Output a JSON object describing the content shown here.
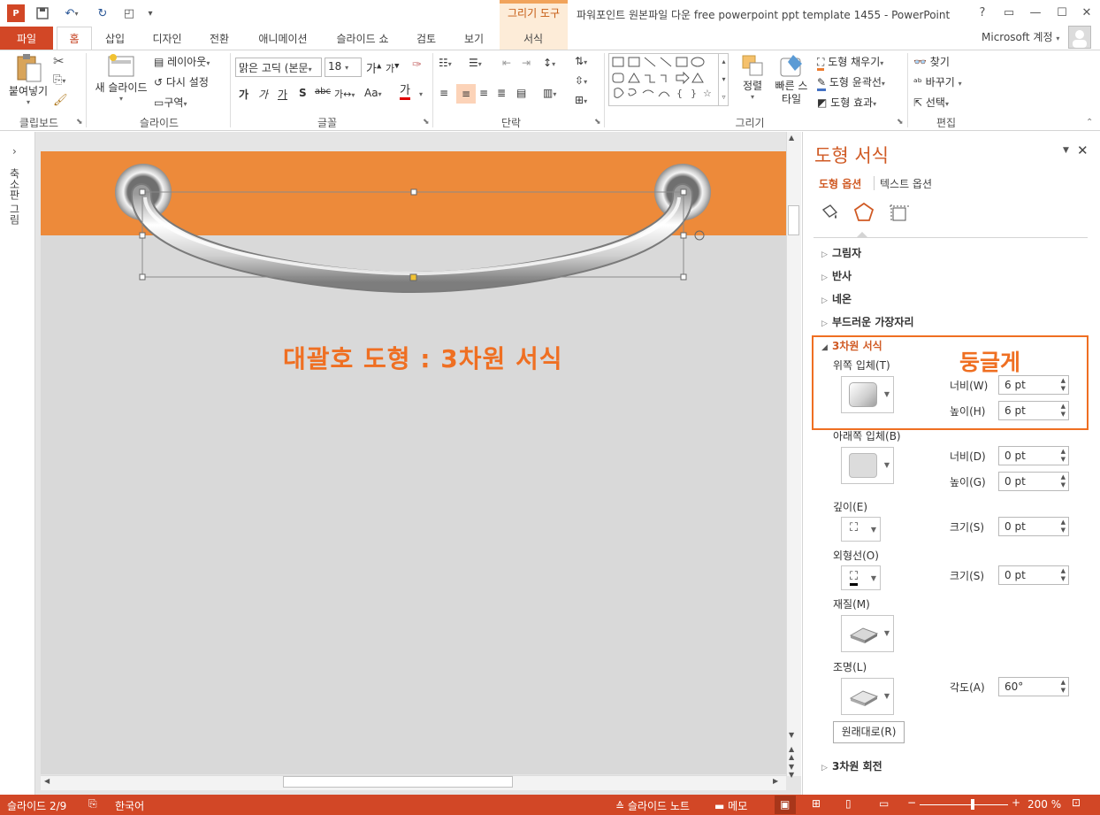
{
  "app": {
    "document_title": "파워포인트 원본파일 다운 free powerpoint ppt template 1455 - PowerPoint",
    "context_tab": "그리기 도구",
    "window_buttons": [
      "?",
      "▭",
      "—",
      "☐",
      "✕"
    ]
  },
  "tabs": {
    "file": "파일",
    "items": [
      "홈",
      "삽입",
      "디자인",
      "전환",
      "애니메이션",
      "슬라이드 쇼",
      "검토",
      "보기",
      "서식"
    ],
    "active": "홈",
    "account": "Microsoft 계정"
  },
  "ribbon": {
    "clipboard": {
      "label": "클립보드",
      "paste": "붙여넣기"
    },
    "slides": {
      "label": "슬라이드",
      "new_slide": "새 슬라이드",
      "layout": "레이아웃",
      "reset": "다시 설정",
      "section": "구역"
    },
    "font": {
      "label": "글꼴",
      "font_name": "맑은 고딕 (본문",
      "font_size": "18"
    },
    "paragraph": {
      "label": "단락"
    },
    "drawing": {
      "label": "그리기",
      "arrange": "정렬",
      "quick_styles": "빠른 스타일",
      "shape_fill": "도형 채우기",
      "shape_outline": "도형 윤곽선",
      "shape_effects": "도형 효과"
    },
    "editing": {
      "label": "편집",
      "find": "찾기",
      "replace": "바꾸기",
      "select": "선택"
    }
  },
  "left_strip": {
    "label": "축소판 그림"
  },
  "slide": {
    "caption": "대괄호 도형 : 3차원 서식",
    "band_color": "#ED8A3A",
    "background_color": "#D9D9D9"
  },
  "pane": {
    "title": "도형 서식",
    "tab_shape": "도형 옵션",
    "tab_text": "텍스트 옵션",
    "sections": {
      "shadow": "그림자",
      "reflection": "반사",
      "glow": "네온",
      "soft_edges": "부드러운 가장자리",
      "format_3d": "3차원 서식",
      "rotation_3d": "3차원 회전"
    },
    "top_bevel": {
      "label": "위쪽 입체(T)",
      "width_label": "너비(W)",
      "width": "6 pt",
      "height_label": "높이(H)",
      "height": "6 pt"
    },
    "bottom_bevel": {
      "label": "아래쪽 입체(B)",
      "width_label": "너비(D)",
      "width": "0 pt",
      "height_label": "높이(G)",
      "height": "0 pt"
    },
    "depth": {
      "label": "깊이(E)",
      "size_label": "크기(S)",
      "size": "0 pt"
    },
    "contour": {
      "label": "외형선(O)",
      "size_label": "크기(S)",
      "size": "0 pt"
    },
    "material": {
      "label": "재질(M)"
    },
    "lighting": {
      "label": "조명(L)",
      "angle_label": "각도(A)",
      "angle": "60°"
    },
    "reset_button": "원래대로(R)",
    "callout": "둥글게"
  },
  "statusbar": {
    "slide_info": "슬라이드 2/9",
    "language": "한국어",
    "notes": "슬라이드 노트",
    "comments": "메모",
    "zoom": "200 %"
  }
}
